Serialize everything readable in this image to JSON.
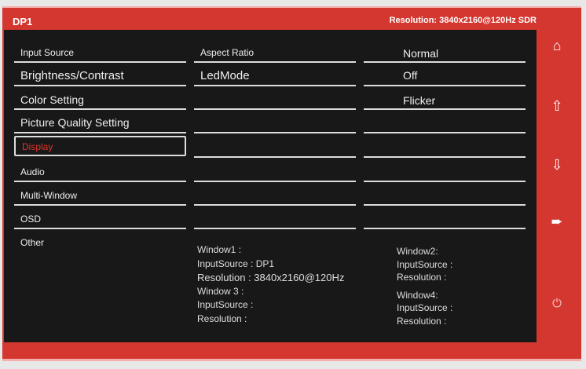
{
  "header": {
    "source": "DP1",
    "resolution": "Resolution: 3840x2160@120Hz  SDR"
  },
  "menu": [
    "Input Source",
    "Brightness/Contrast",
    "Color Setting",
    "Picture Quality Setting",
    "Display",
    "Audio",
    "Multi-Window",
    "OSD",
    "Other"
  ],
  "submenu": [
    "Aspect Ratio",
    "LedMode"
  ],
  "values": [
    "Normal",
    "Off",
    "Flicker"
  ],
  "windows": {
    "w1": [
      "Window1 :",
      "InputSource : DP1",
      "Resolution : 3840x2160@120Hz"
    ],
    "w3": [
      "Window 3 :",
      "InputSource :",
      "Resolution :"
    ],
    "w2": [
      "Window2:",
      "InputSource :",
      "Resolution :"
    ],
    "w4": [
      "Window4:",
      "InputSource :",
      "Resolution :"
    ]
  },
  "nav_icons": [
    "home-icon",
    "arrow-up-icon",
    "arrow-down-icon",
    "exit-icon",
    "power-icon"
  ],
  "colors": {
    "frame": "#d3372f",
    "panel": "#181818",
    "selected_text": "#e0332b"
  }
}
